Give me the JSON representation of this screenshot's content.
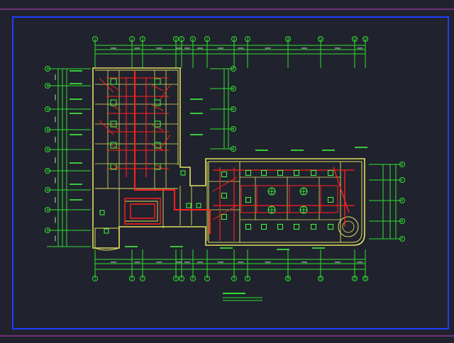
{
  "colors": {
    "background": "#20222d",
    "frame": "#1d3dff",
    "edge_line": "#c040c0",
    "wall": "#e0e060",
    "dimension": "#30e030",
    "pipe": "#ff2020",
    "fixture": "#40ff40",
    "label": "#d0d0d0"
  },
  "drawing": {
    "column_axes_top": [
      "1",
      "2",
      "3",
      "4",
      "5",
      "6",
      "7",
      "8",
      "9",
      "10",
      "11",
      "12",
      "13"
    ],
    "row_axes_left": [
      "A",
      "B",
      "C",
      "D",
      "E",
      "F",
      "G",
      "H",
      "J"
    ],
    "row_axes_right": [
      "K",
      "L",
      "M",
      "N",
      "P"
    ],
    "title_block": "",
    "title_sub": ""
  }
}
